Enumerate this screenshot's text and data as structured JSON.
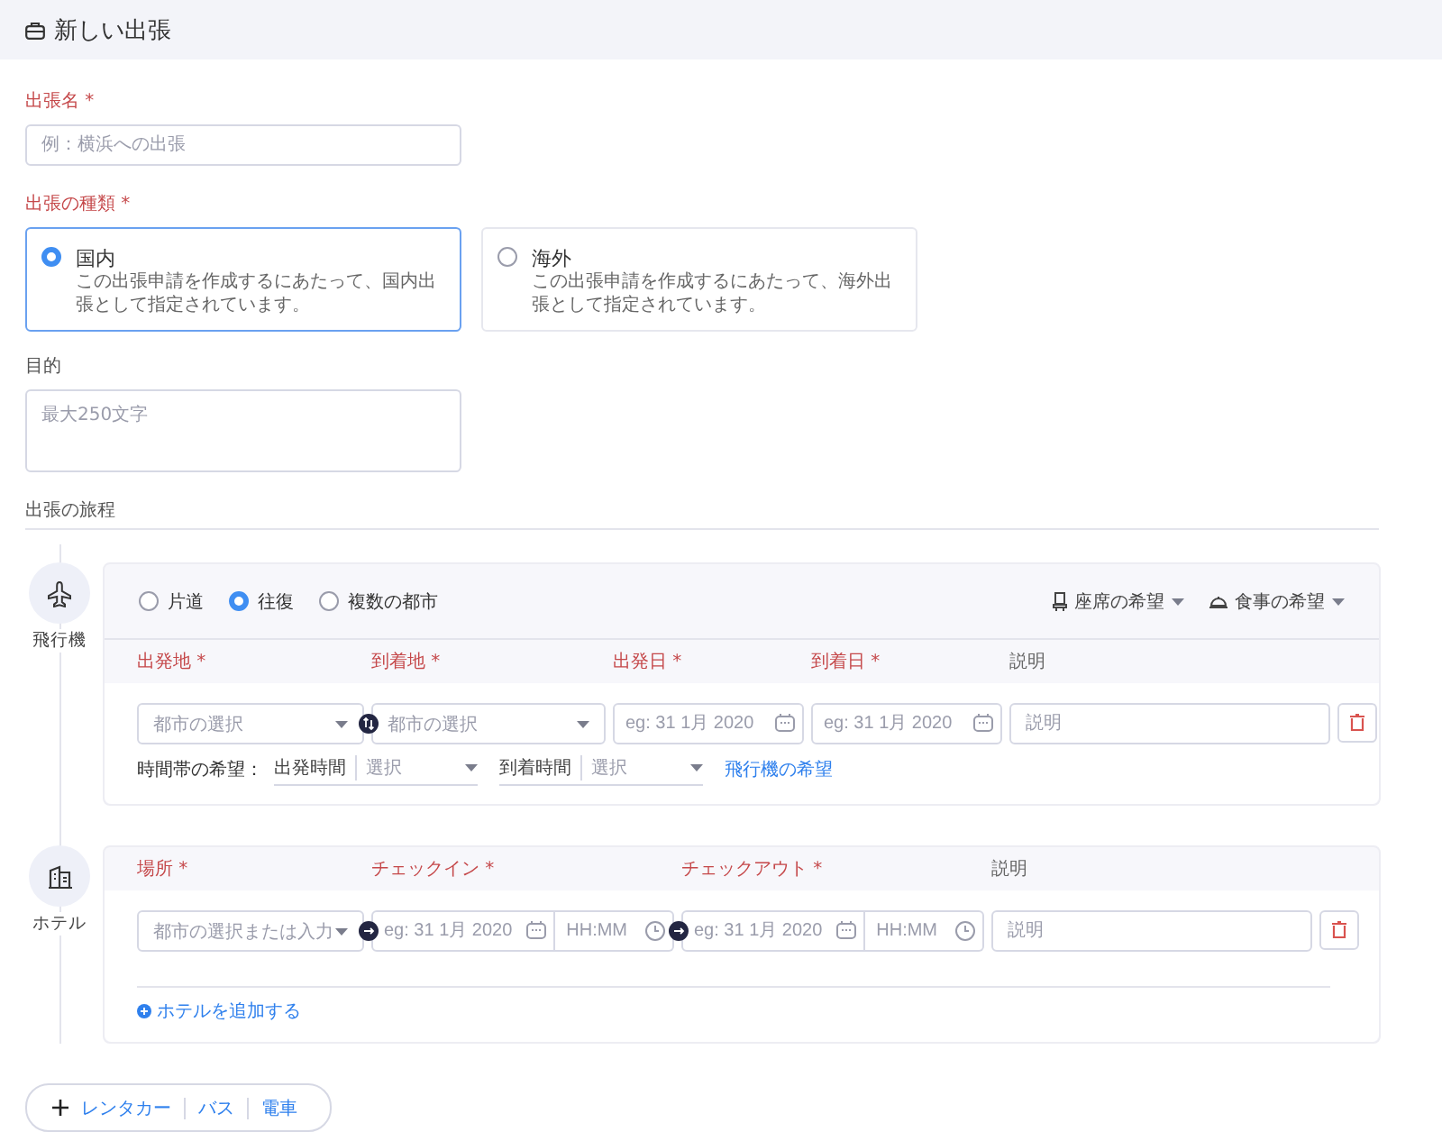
{
  "header": {
    "title": "新しい出張"
  },
  "trip_name": {
    "label": "出張名 *",
    "required": true,
    "placeholder": "例：横浜への出張"
  },
  "trip_type": {
    "label": "出張の種類 *",
    "required": true,
    "options": [
      {
        "title": "国内",
        "description": "この出張申請を作成するにあたって、国内出張として指定されています。",
        "selected": true
      },
      {
        "title": "海外",
        "description": "この出張申請を作成するにあたって、海外出張として指定されています。",
        "selected": false
      }
    ]
  },
  "purpose": {
    "label": "目的",
    "required": false,
    "placeholder": "最大250文字"
  },
  "itinerary": {
    "heading": "出張の旅程",
    "segments": [
      {
        "kind": "flight",
        "label": "飛行機",
        "trip_options": [
          {
            "label": "片道",
            "selected": false
          },
          {
            "label": "往復",
            "selected": true
          },
          {
            "label": "複数の都市",
            "selected": false
          }
        ],
        "preferences": [
          {
            "kind": "seat",
            "label": "座席の希望"
          },
          {
            "kind": "meal",
            "label": "食事の希望"
          }
        ],
        "columns": [
          {
            "label": "出発地 *",
            "required": true
          },
          {
            "label": "到着地 *",
            "required": true
          },
          {
            "label": "出発日 *",
            "required": true
          },
          {
            "label": "到着日 *",
            "required": true
          },
          {
            "label": "説明",
            "required": false
          }
        ],
        "fields": [
          {
            "kind": "select",
            "placeholder": "都市の選択"
          },
          {
            "kind": "select",
            "placeholder": "都市の選択"
          },
          {
            "kind": "date",
            "placeholder": "eg: 31 1月 2020"
          },
          {
            "kind": "date",
            "placeholder": "eg: 31 1月 2020"
          },
          {
            "kind": "text",
            "placeholder": "説明"
          }
        ],
        "time_preference": {
          "label": "時間帯の希望：",
          "selects": [
            {
              "label": "出発時間",
              "placeholder": "選択"
            },
            {
              "label": "到着時間",
              "placeholder": "選択"
            }
          ],
          "link": "飛行機の希望"
        }
      },
      {
        "kind": "hotel",
        "label": "ホテル",
        "columns": [
          {
            "label": "場所 *",
            "required": true
          },
          {
            "label": "チェックイン *",
            "required": true
          },
          {
            "label": "チェックアウト *",
            "required": true
          },
          {
            "label": "説明",
            "required": false
          }
        ],
        "fields": [
          {
            "kind": "select",
            "placeholder": "都市の選択または入力"
          },
          {
            "kind": "datetime",
            "placeholder": "eg: 31 1月 2020",
            "time_placeholder": "HH:MM"
          },
          {
            "kind": "datetime",
            "placeholder": "eg: 31 1月 2020",
            "time_placeholder": "HH:MM"
          },
          {
            "kind": "text",
            "placeholder": "説明"
          }
        ],
        "add_link": "ホテルを追加する"
      }
    ]
  },
  "add_transport": {
    "items": [
      "レンタカー",
      "バス",
      "電車"
    ]
  }
}
